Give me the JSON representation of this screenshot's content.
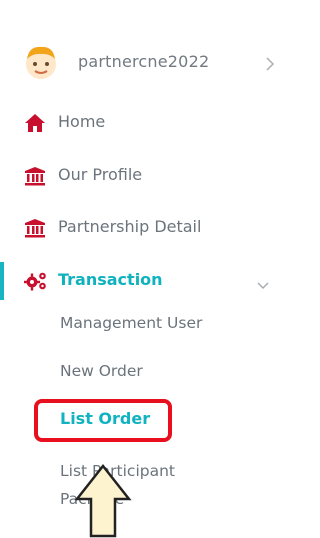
{
  "user": {
    "name": "partnercne2022"
  },
  "nav": {
    "home": "Home",
    "our_profile": "Our Profile",
    "partnership_detail": "Partnership Detail",
    "transaction": "Transaction"
  },
  "submenu": {
    "management_user": "Management User",
    "new_order": "New Order",
    "list_order": "List Order",
    "list_participant_package_line1": "List Participant",
    "list_participant_package_line2": "Package"
  },
  "colors": {
    "accent": "#17b5c1",
    "icon_red": "#c8102e",
    "highlight": "#e8101f",
    "text": "#6b747c"
  },
  "icons": {
    "avatar": "user-avatar",
    "home": "home-icon",
    "profile": "bank-icon",
    "partnership": "bank-icon",
    "transaction": "gears-icon",
    "user_chevron": "chevron-right-icon",
    "transaction_chevron": "chevron-down-icon",
    "pointer": "arrow-up-icon"
  }
}
